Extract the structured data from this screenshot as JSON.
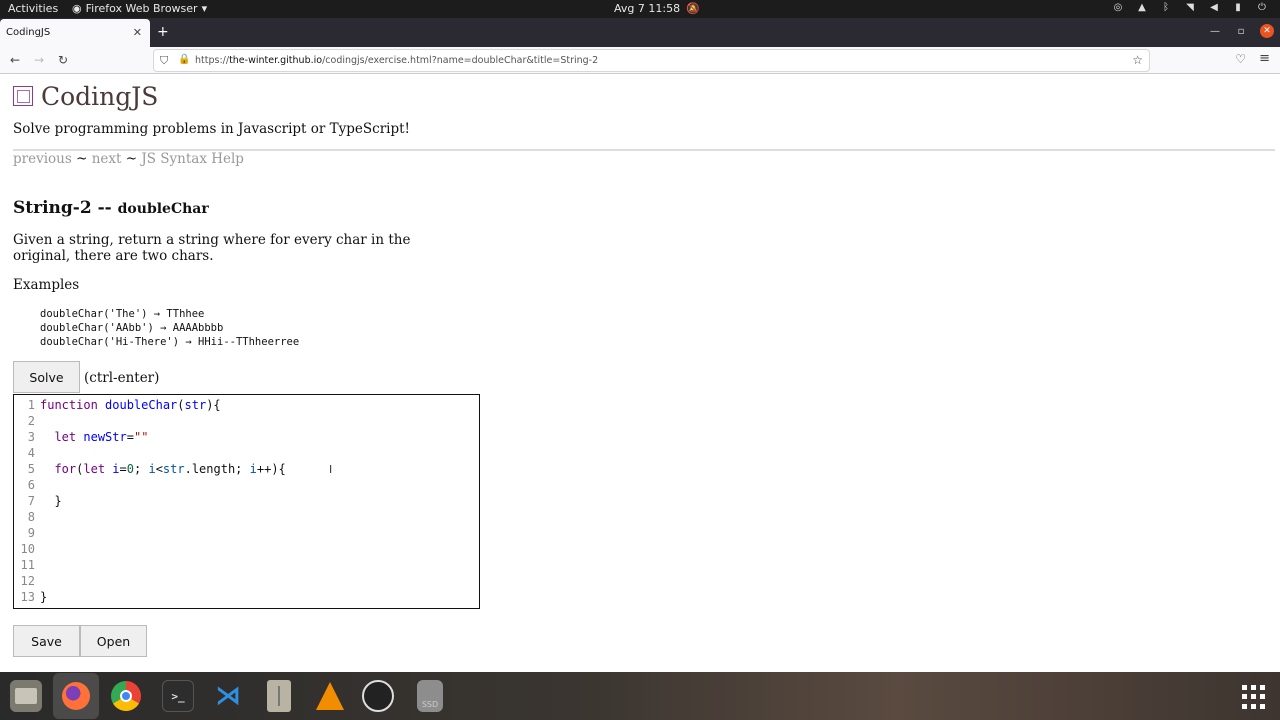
{
  "topbar": {
    "activities": "Activities",
    "app_name": "Firefox Web Browser",
    "clock": "Avg 7  11:58"
  },
  "browser": {
    "tab_title": "CodingJS",
    "url_prefix": "https://",
    "url_host": "the-winter.github.io",
    "url_path": "/codingjs/exercise.html?name=doubleChar&title=String-2"
  },
  "site": {
    "title": "CodingJS",
    "tagline": "Solve programming problems in Javascript or TypeScript!",
    "nav": {
      "previous": "previous",
      "sep1": " ~ ",
      "next": "next",
      "sep2": " ~ ",
      "help": "JS Syntax Help"
    }
  },
  "problem": {
    "category": "String-2 --",
    "name": "doubleChar",
    "description": "Given a string, return a string where for every char in the original, there are two chars.",
    "examples_label": "Examples",
    "examples": [
      "doubleChar('The') → TThhee",
      "doubleChar('AAbb') → AAAAbbbb",
      "doubleChar('Hi-There') → HHii--TThheerree"
    ]
  },
  "controls": {
    "solve_label": "Solve",
    "solve_hint": "(ctrl-enter)",
    "save_label": "Save",
    "open_label": "Open"
  },
  "editor": {
    "line_numbers": [
      "1",
      "2",
      "3",
      "4",
      "5",
      "6",
      "7",
      "8",
      "9",
      "10",
      "11",
      "12",
      "13"
    ]
  },
  "taskbar": {
    "apps": [
      "files-icon",
      "firefox-icon",
      "chrome-icon",
      "terminal-icon",
      "vscode-icon",
      "archive-icon",
      "vlc-icon",
      "obs-icon",
      "ssd-icon"
    ],
    "ssd_label": "SSD"
  }
}
